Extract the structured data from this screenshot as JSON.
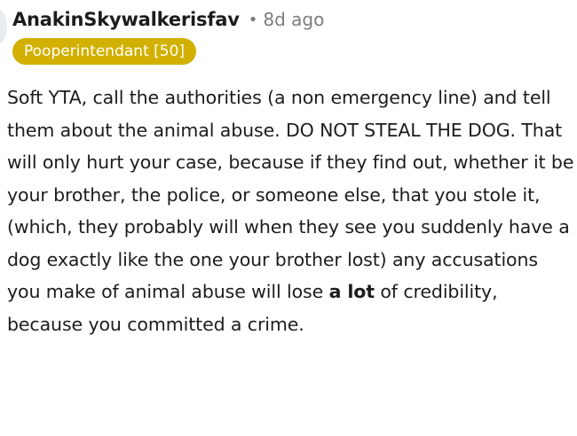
{
  "comment": {
    "username": "AnakinSkywalkerisfav",
    "separator": "•",
    "timestamp": "8d ago",
    "flair": "Pooperintendant [50]",
    "body": {
      "text_before_bold": "Soft YTA, call the authorities (a non emergency line) and tell them about the animal abuse. DO NOT STEAL THE DOG. That will only hurt your case, because if they find out, whether it be your brother, the police, or someone else, that you stole it, (which, they probably will when they see you suddenly have a dog exactly like the one your brother lost) any accusations you make of animal abuse will lose ",
      "bold_text": "a lot",
      "text_after_bold": " of credibility, because you committed a crime."
    }
  },
  "colors": {
    "flair_background": "#d1b000",
    "flair_text": "#ffffff",
    "meta_text": "#7c7c7c",
    "body_text": "#1c1c1c"
  }
}
